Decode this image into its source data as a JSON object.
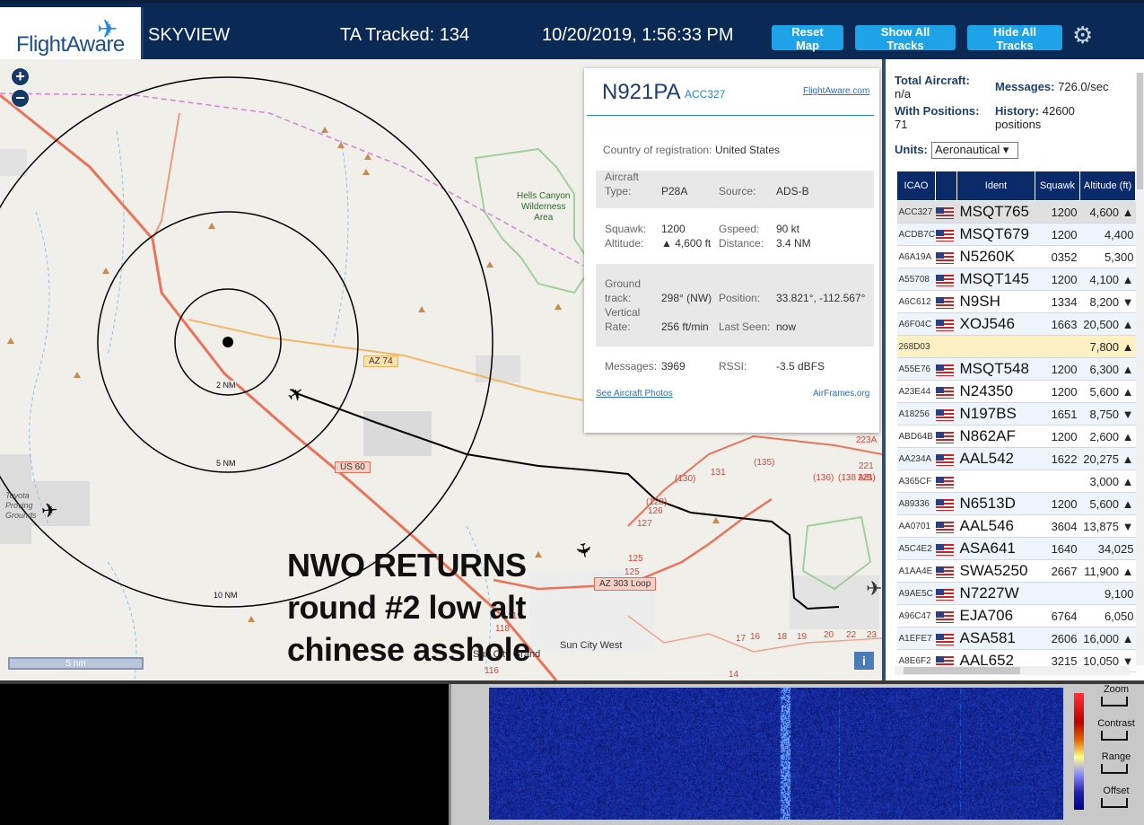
{
  "header": {
    "logo_text": "FlightAware",
    "app_name": "SKYVIEW",
    "tracked_label": "TA Tracked: 134",
    "datetime": "10/20/2019, 1:56:33 PM",
    "buttons": {
      "reset": "Reset Map",
      "show": "Show All Tracks",
      "hide": "Hide All Tracks"
    }
  },
  "map": {
    "labels": {
      "hells_canyon": "Hells Canyon",
      "wilderness": "Wilderness",
      "area": "Area",
      "az74": "AZ 74",
      "us60": "US 60",
      "az303": "AZ 303 Loop",
      "ring2": "2 NM",
      "ring5": "5 NM",
      "ring10": "10 NM",
      "toyota1": "Toyota",
      "toyota2": "Proving",
      "toyota3": "Grounds",
      "sun_city_grand": "Sun City Grand",
      "sun_city_west": "Sun City West",
      "scale": "5 nm"
    },
    "annotation": [
      "NWO RETURNS",
      "round #2 low alt",
      "chinese asshole"
    ]
  },
  "popup": {
    "registration": "N921PA",
    "hex": "ACC327",
    "flightaware_link": "FlightAware.com",
    "country_label": "Country of registration:",
    "country": "United States",
    "aircraft_label": "Aircraft",
    "type_label": "Type:",
    "type": "P28A",
    "source_label": "Source:",
    "source": "ADS-B",
    "squawk_label": "Squawk:",
    "squawk": "1200",
    "gspeed_label": "Gspeed:",
    "gspeed": "90 kt",
    "altitude_label": "Altitude:",
    "altitude": "▲ 4,600 ft",
    "distance_label": "Distance:",
    "distance": "3.4 NM",
    "ground_label": "Ground",
    "track_label": "track:",
    "track": "298° (NW)",
    "position_label": "Position:",
    "position": "33.821°, -112.567°",
    "vertical_label": "Vertical",
    "rate_label": "Rate:",
    "rate": "256 ft/min",
    "lastseen_label": "Last Seen:",
    "lastseen": "now",
    "messages_label": "Messages:",
    "messages": "3969",
    "rssi_label": "RSSI:",
    "rssi": "-3.5 dBFS",
    "photos_link": "See Aircraft Photos",
    "airframes_link": "AirFrames.org"
  },
  "side": {
    "total_label": "Total Aircraft:",
    "total": "n/a",
    "messages_label": "Messages:",
    "messages": "726.0/sec",
    "withpos_label": "With Positions:",
    "withpos": "71",
    "history_label": "History:",
    "history": "42600",
    "history_unit": "positions",
    "units_label": "Units:",
    "units_value": "Aeronautical ▾",
    "columns": [
      "ICAO",
      "Ident",
      "Squawk",
      "Altitude (ft)"
    ],
    "rows": [
      {
        "icao": "ACC327",
        "ident": "MSQT765",
        "squawk": "1200",
        "alt": "4,600 ▲",
        "flag": true
      },
      {
        "icao": "ACDB7C",
        "ident": "MSQT679",
        "squawk": "1200",
        "alt": "4,400",
        "flag": true
      },
      {
        "icao": "A6A19A",
        "ident": "N5260K",
        "squawk": "0352",
        "alt": "5,300",
        "flag": true
      },
      {
        "icao": "A55708",
        "ident": "MSQT145",
        "squawk": "1200",
        "alt": "4,100 ▲",
        "flag": true
      },
      {
        "icao": "A6C612",
        "ident": "N9SH",
        "squawk": "1334",
        "alt": "8,200 ▼",
        "flag": true
      },
      {
        "icao": "A6F04C",
        "ident": "XOJ546",
        "squawk": "1663",
        "alt": "20,500 ▲",
        "flag": true
      },
      {
        "icao": "268D03",
        "ident": "",
        "squawk": "",
        "alt": "7,800 ▲",
        "flag": false
      },
      {
        "icao": "A55E76",
        "ident": "MSQT548",
        "squawk": "1200",
        "alt": "6,300 ▲",
        "flag": true
      },
      {
        "icao": "A23E44",
        "ident": "N24350",
        "squawk": "1200",
        "alt": "5,600 ▲",
        "flag": true
      },
      {
        "icao": "A18256",
        "ident": "N197BS",
        "squawk": "1651",
        "alt": "8,750 ▼",
        "flag": true
      },
      {
        "icao": "ABD64B",
        "ident": "N862AF",
        "squawk": "1200",
        "alt": "2,600 ▲",
        "flag": true
      },
      {
        "icao": "AA234A",
        "ident": "AAL542",
        "squawk": "1622",
        "alt": "20,275 ▲",
        "flag": true
      },
      {
        "icao": "A365CF",
        "ident": "",
        "squawk": "",
        "alt": "3,000 ▲",
        "flag": true
      },
      {
        "icao": "A89336",
        "ident": "N6513D",
        "squawk": "1200",
        "alt": "5,600 ▲",
        "flag": true
      },
      {
        "icao": "AA0701",
        "ident": "AAL546",
        "squawk": "3604",
        "alt": "13,875 ▼",
        "flag": true
      },
      {
        "icao": "A5C4E2",
        "ident": "ASA641",
        "squawk": "1640",
        "alt": "34,025",
        "flag": true
      },
      {
        "icao": "A1AA4E",
        "ident": "SWA5250",
        "squawk": "2667",
        "alt": "11,900 ▲",
        "flag": true
      },
      {
        "icao": "A9AE5C",
        "ident": "N7227W",
        "squawk": "",
        "alt": "9,100",
        "flag": true
      },
      {
        "icao": "A96C47",
        "ident": "EJA706",
        "squawk": "6764",
        "alt": "6,050",
        "flag": true
      },
      {
        "icao": "A1EFE7",
        "ident": "ASA581",
        "squawk": "2606",
        "alt": "16,000 ▲",
        "flag": true
      },
      {
        "icao": "A8E6F2",
        "ident": "AAL652",
        "squawk": "3215",
        "alt": "10,050 ▼",
        "flag": true
      }
    ]
  },
  "spectrum": {
    "controls": [
      "Zoom",
      "Contrast",
      "Range",
      "Offset"
    ]
  }
}
